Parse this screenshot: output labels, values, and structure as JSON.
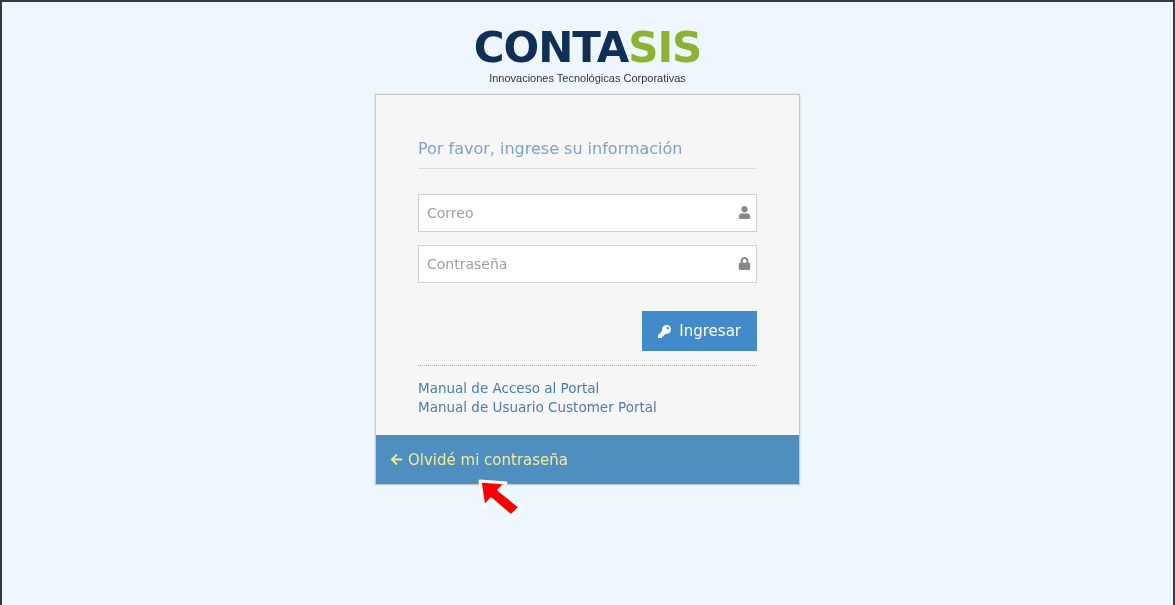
{
  "logo": {
    "primary": "CONTA",
    "accent": "SIS",
    "tagline": "Innovaciones Tecnológicas Corporativas"
  },
  "login": {
    "title": "Por favor, ingrese su información",
    "fields": [
      {
        "kind": "user",
        "placeholder": "Correo"
      },
      {
        "kind": "lock",
        "placeholder": "Contraseña"
      }
    ],
    "submit": "Ingresar",
    "links": [
      "Manual de Acceso al Portal",
      "Manual de Usuario Customer Portal"
    ],
    "footer_link": "Olvidé mi contraseña"
  },
  "annotation": {
    "kind": "arrow"
  }
}
